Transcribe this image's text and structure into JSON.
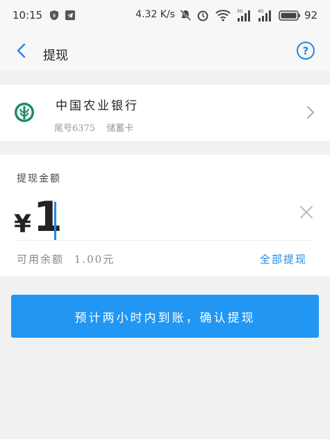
{
  "status_bar": {
    "time": "10:15",
    "net_speed": "4.32 K/s",
    "battery": "92"
  },
  "header": {
    "title": "提现"
  },
  "bank": {
    "name": "中国农业银行",
    "tail": "尾号6375",
    "card_type": "储蓄卡"
  },
  "amount": {
    "label": "提现金额",
    "currency": "¥",
    "value": "1"
  },
  "balance": {
    "label": "可用余额",
    "value": "1.00元"
  },
  "withdraw_all": {
    "label": "全部提现"
  },
  "confirm": {
    "label": "预计两小时内到账，确认提现"
  },
  "colors": {
    "accent": "#2196f3",
    "link": "#1e88e5",
    "bank_green": "#1a8a6a"
  },
  "icons": {
    "back": "back-arrow-icon",
    "help": "help-circle-icon",
    "bank_logo": "abc-bank-logo-icon",
    "chevron": "chevron-right-icon",
    "clear": "close-icon"
  }
}
